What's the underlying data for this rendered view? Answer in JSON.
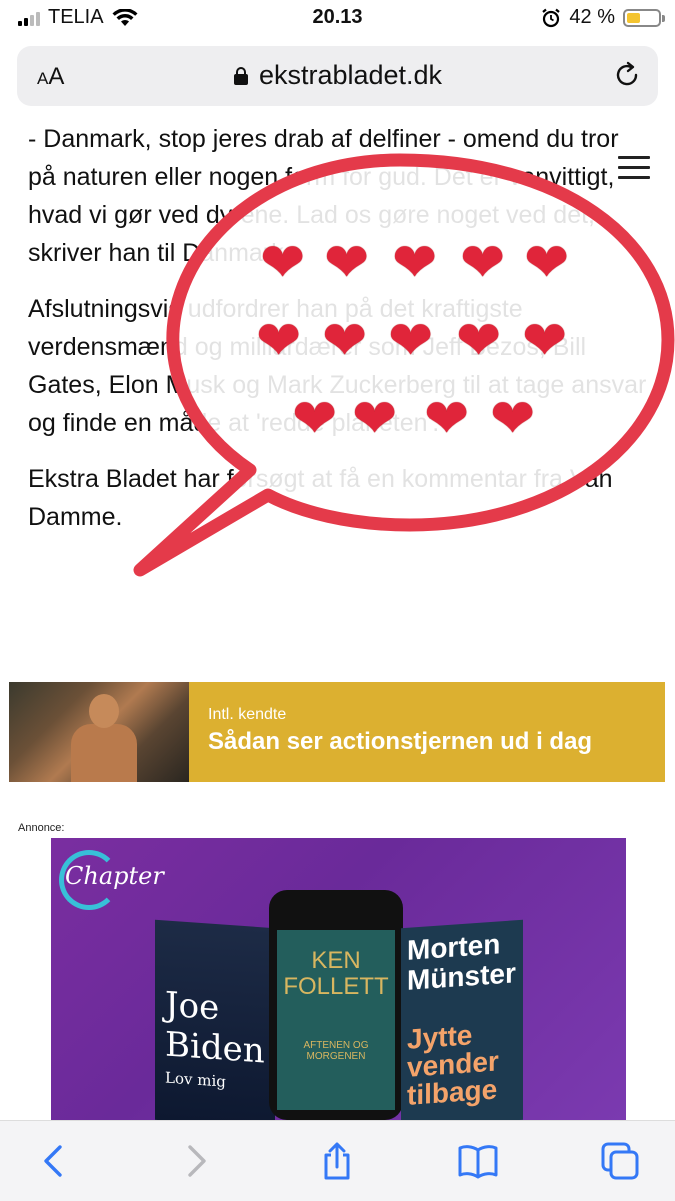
{
  "status_bar": {
    "carrier": "TELIA",
    "time": "20.13",
    "battery_percent": "42 %",
    "battery_level": 0.42
  },
  "url_bar": {
    "text_size_label": "AA",
    "domain": "ekstrabladet.dk"
  },
  "article": {
    "paragraphs": [
      "- Danmark, stop jeres drab af delfiner - omend du tror på naturen eller nogen form for gud. Det er vanvittigt, hvad vi gør ved dyrene. Lad os gøre noget ved det, skriver han til Danmark.",
      "Afslutningsvis udfordrer han på det kraftigste verdensmænd og milliardærer som Jeff Bezos, Bill Gates, Elon Musk og Mark Zuckerberg til at tage ansvar og finde en måde at 'redde planeten'.",
      "Ekstra Bladet har forsøgt at få en kommentar fra Van Damme."
    ]
  },
  "overlay": {
    "heart_icon": "❤️",
    "heart_count": 14,
    "bubble_color": "#e43a4a"
  },
  "promo": {
    "kicker": "Intl. kendte",
    "title": "Sådan ser actionstjernen ud i dag",
    "color": "#dcb030"
  },
  "ad": {
    "label": "Annonce:",
    "brand": "Chapter",
    "book1_title": "Joe Biden",
    "book1_subtitle": "Lov mig",
    "book2_title": "KEN FOLLETT",
    "book2_subtitle": "AFTENEN OG MORGENEN",
    "book3_author": "Morten Münster",
    "book3_title": "Jytte vender tilbage"
  },
  "toolbar": {
    "icons": [
      "back-icon",
      "forward-icon",
      "share-icon",
      "bookmarks-icon",
      "tabs-icon"
    ],
    "accent": "#3478f6"
  }
}
